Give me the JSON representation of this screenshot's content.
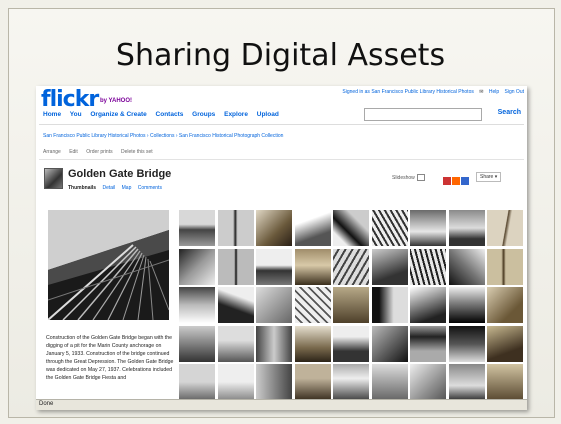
{
  "slide": {
    "title": "Sharing Digital Assets"
  },
  "header": {
    "logo_text": "flickr",
    "logo_suffix": "by YAHOO!",
    "signed_in": "Signed in as San Francisco Public Library Historical Photos",
    "top_links": [
      "Help",
      "Sign Out"
    ],
    "search_placeholder": "",
    "search_button": "Search"
  },
  "nav": {
    "home": "Home",
    "you": "You",
    "organize": "Organize & Create",
    "contacts": "Contacts",
    "groups": "Groups",
    "explore": "Explore",
    "upload": "Upload"
  },
  "breadcrumb": "San Francisco Public Library Historical Photos › Collections › San Francisco Historical Photograph Collection",
  "toolbar": {
    "arrange": "Arrange",
    "edit": "Edit",
    "order_prints": "Order prints",
    "delete": "Delete this set"
  },
  "set": {
    "title": "Golden Gate Bridge",
    "tabs": [
      "Thumbnails",
      "Detail",
      "Map",
      "Comments"
    ],
    "slideshow": "Slideshow",
    "share": "Share ▾",
    "caption": "Construction of the Golden Gate Bridge began with the digging of a pit for the Marin County anchorage on January 5, 1933. Construction of the bridge continued through the Great Depression. The Golden Gate Bridge was dedicated on May 27, 1937. Celebrations included the Golden Gate Bridge Fiesta and"
  },
  "status": "Done",
  "colors": {
    "flickr_blue": "#0063dc",
    "flickr_pink": "#ff0084",
    "slide_bg": "#f1f0e9"
  },
  "share_icon_colors": [
    "#c33",
    "#f60",
    "#36c"
  ],
  "thumbnails": [
    {
      "g": "linear-gradient(180deg,#d8d8d8 40%,#444 55%,#999)"
    },
    {
      "g": "linear-gradient(90deg,#ccc 42%,#222 48%,#ccc 54%)"
    },
    {
      "g": "linear-gradient(135deg,#e0d7c4,#6b5a3c 60%,#2a2016)"
    },
    {
      "g": "linear-gradient(160deg,#fff 30%,#555 70%)"
    },
    {
      "g": "linear-gradient(45deg,#eee 20%,#111 40%,#ccc 70%)"
    },
    {
      "g": "repeating-linear-gradient(60deg,#eee 0 3px,#333 3px 5px)"
    },
    {
      "g": "linear-gradient(180deg,#6a6a6a,#e6e6e6 60%,#333)"
    },
    {
      "g": "linear-gradient(0deg,#333 20%,#dcdcdc 50%,#8a8a8a)"
    },
    {
      "g": "linear-gradient(100deg,#dcd3c0 50%,#57462e 52%,#dcd3c0 60%)"
    },
    {
      "g": "linear-gradient(135deg,#222,#999 50%,#eee)"
    },
    {
      "g": "linear-gradient(90deg,#bbb 45%,#111 50%,#bbb 55%)"
    },
    {
      "g": "linear-gradient(180deg,#eee 45%,#333 60%,#777)"
    },
    {
      "g": "linear-gradient(180deg,#a08d6a,#d8c9a8 45%,#3a2e1c)"
    },
    {
      "g": "repeating-linear-gradient(120deg,#ddd 0 4px,#444 4px 6px)"
    },
    {
      "g": "linear-gradient(160deg,#ccc,#333 70%)"
    },
    {
      "g": "repeating-linear-gradient(75deg,#e8e8e8 0 3px,#222 3px 5px)"
    },
    {
      "g": "linear-gradient(45deg,#111,#777 50%,#eee)"
    },
    {
      "g": "linear-gradient(90deg,#cbbf9f 40%,#4b3b22 46%,#cbbf9f 52%)"
    },
    {
      "g": "linear-gradient(180deg,#444,#bbb 50%,#fff)"
    },
    {
      "g": "linear-gradient(200deg,#eee 30%,#222 60%)"
    },
    {
      "g": "linear-gradient(135deg,#ddd,#666)"
    },
    {
      "g": "repeating-linear-gradient(45deg,#eee 0 4px,#555 4px 6px)"
    },
    {
      "g": "linear-gradient(180deg,#b7a988,#4e402a)"
    },
    {
      "g": "linear-gradient(90deg,#111 20%,#ddd 60%)"
    },
    {
      "g": "linear-gradient(160deg,#fff,#222 80%)"
    },
    {
      "g": "linear-gradient(0deg,#000,#888 60%,#eee)"
    },
    {
      "g": "linear-gradient(135deg,#d9cdb1,#6b5837 70%)"
    },
    {
      "g": "linear-gradient(180deg,#ccc,#333)"
    },
    {
      "g": "linear-gradient(180deg,#ddd 40%,#555)"
    },
    {
      "g": "linear-gradient(90deg,#444,#ccc 50%,#444)"
    },
    {
      "g": "linear-gradient(180deg,#e6dfcf,#7a6a4d 60%,#2c2418)"
    },
    {
      "g": "linear-gradient(180deg,#eee 30%,#333 70%)"
    },
    {
      "g": "linear-gradient(135deg,#bbb,#111)"
    },
    {
      "g": "linear-gradient(180deg,#999,#222 30%,#aaa 70%)"
    },
    {
      "g": "linear-gradient(180deg,#111,#555 50%,#ddd)"
    },
    {
      "g": "linear-gradient(160deg,#c8b991,#3e3020 70%)"
    },
    {
      "g": "linear-gradient(180deg,#d5d5d5 50%,#666)"
    },
    {
      "g": "linear-gradient(180deg,#eee 50%,#888)"
    },
    {
      "g": "linear-gradient(90deg,#ccc,#444)"
    },
    {
      "g": "linear-gradient(180deg,#bfb29a 40%,#3b2f20)"
    },
    {
      "g": "linear-gradient(180deg,#aaa,#eee 40%,#444)"
    },
    {
      "g": "linear-gradient(180deg,#ddd,#666)"
    },
    {
      "g": "linear-gradient(135deg,#eee,#555)"
    },
    {
      "g": "linear-gradient(180deg,#888,#ddd 60%,#333)"
    },
    {
      "g": "linear-gradient(180deg,#d2c4a2,#5a4a32)"
    }
  ]
}
